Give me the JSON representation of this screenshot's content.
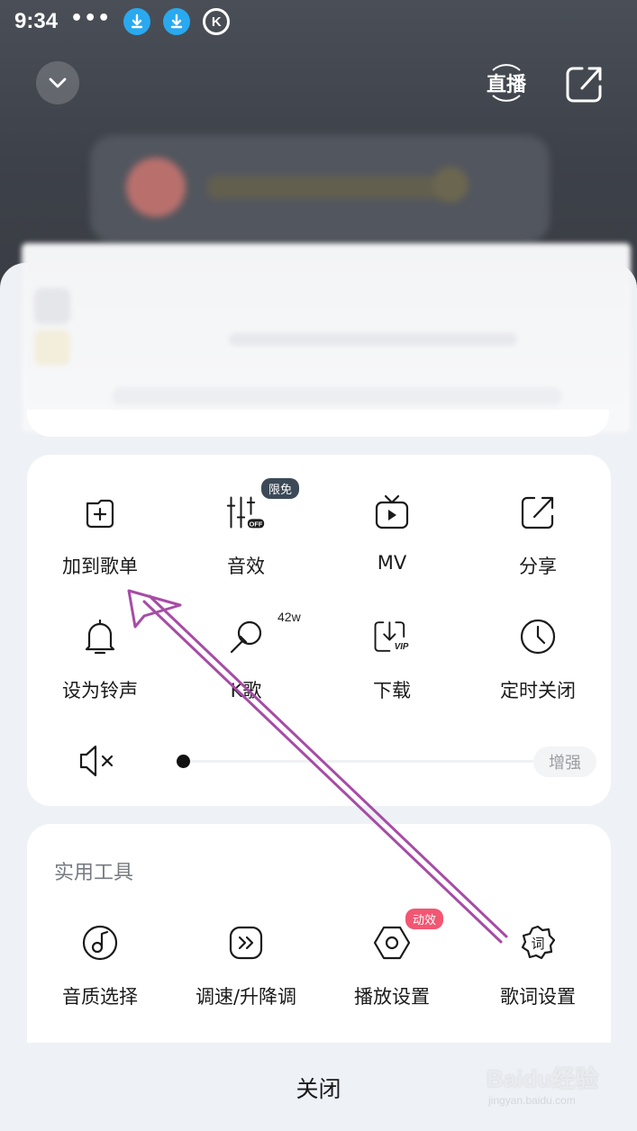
{
  "status_bar": {
    "time": "9:34",
    "more": "•••",
    "k_icon_letter": "K"
  },
  "header": {
    "collapse_icon": "chevron-down-icon",
    "live_label": "直播",
    "share_icon": "share-icon"
  },
  "menu": {
    "items": [
      {
        "label": "加到歌单",
        "icon": "add-to-playlist-icon"
      },
      {
        "label": "音效",
        "icon": "equalizer-off-icon",
        "badge": "限免"
      },
      {
        "label": "MV",
        "icon": "tv-play-icon"
      },
      {
        "label": "分享",
        "icon": "share-icon"
      },
      {
        "label": "设为铃声",
        "icon": "bell-icon"
      },
      {
        "label": "K歌",
        "icon": "microphone-icon",
        "superscript": "42w"
      },
      {
        "label": "下载",
        "icon": "download-vip-icon",
        "tag": "VIP"
      },
      {
        "label": "定时关闭",
        "icon": "clock-icon"
      }
    ],
    "volume": {
      "level": 0,
      "boost_label": "增强"
    }
  },
  "tools": {
    "title": "实用工具",
    "items": [
      {
        "label": "音质选择",
        "icon": "disc-note-icon"
      },
      {
        "label": "调速/升降调",
        "icon": "fast-forward-icon"
      },
      {
        "label": "播放设置",
        "icon": "hexagon-settings-icon",
        "badge": "动效"
      },
      {
        "label": "歌词设置",
        "icon": "lyrics-badge-icon",
        "glyph": "词"
      }
    ]
  },
  "close_label": "关闭",
  "watermark": {
    "brand": "Baidu经验",
    "url": "jingyan.baidu.com"
  },
  "colors": {
    "accent_badge_dark": "#3c4a58",
    "accent_badge_red": "#f25672",
    "annotation_arrow": "#a64ca6",
    "download_icon_blue": "#29a9f0"
  }
}
